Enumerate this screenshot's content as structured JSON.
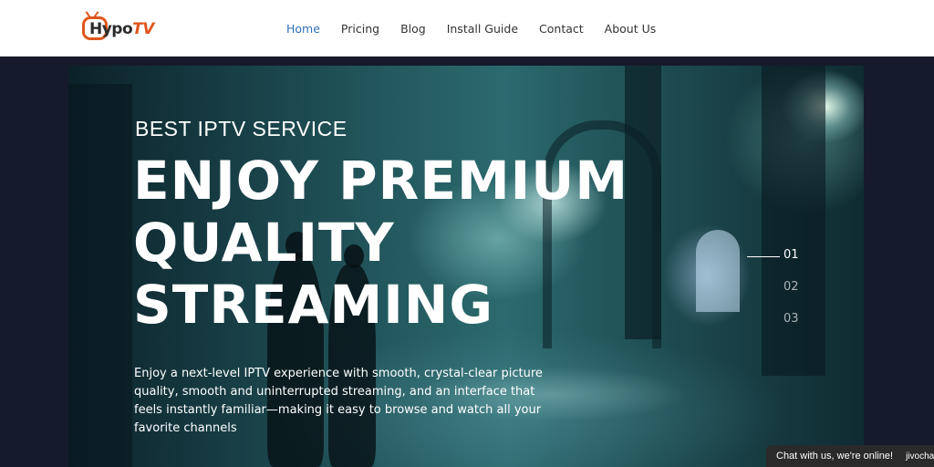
{
  "header": {
    "logo": {
      "text_main": "Hypo",
      "text_accent": "TV"
    },
    "nav": [
      {
        "label": "Home",
        "active": true
      },
      {
        "label": "Pricing",
        "active": false
      },
      {
        "label": "Blog",
        "active": false
      },
      {
        "label": "Install Guide",
        "active": false
      },
      {
        "label": "Contact",
        "active": false
      },
      {
        "label": "About Us",
        "active": false
      }
    ]
  },
  "hero": {
    "kicker": "BEST IPTV SERVICE",
    "title_line1": "ENJOY PREMIUM",
    "title_line2": "QUALITY",
    "title_line3": "STREAMING",
    "description": "Enjoy a next-level IPTV experience with smooth, crystal-clear picture quality, smooth and uninterrupted streaming, and an interface that feels instantly familiar—making it easy to browse and watch all your favorite channels",
    "slides": [
      {
        "label": "01",
        "active": true
      },
      {
        "label": "02",
        "active": false
      },
      {
        "label": "03",
        "active": false
      }
    ]
  },
  "chat": {
    "message": "Chat with us, we're online!",
    "brand": "jivochat"
  },
  "colors": {
    "accent": "#e0561c",
    "nav_active": "#2c70b9",
    "background": "#151a2c",
    "chat_bg": "#2a2a2a"
  }
}
